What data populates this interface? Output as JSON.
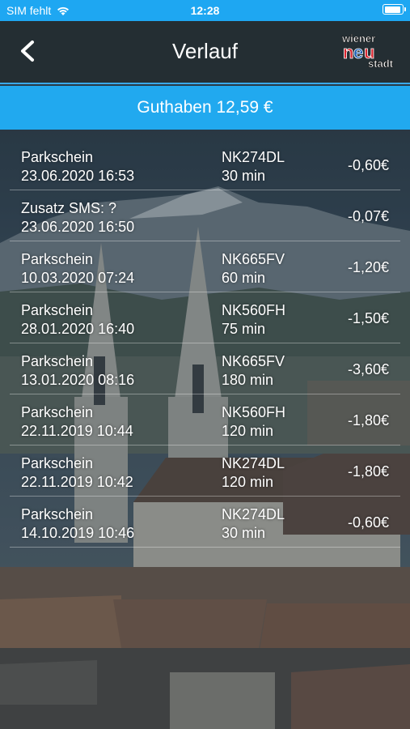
{
  "status_bar": {
    "carrier": "SIM fehlt",
    "time": "12:28"
  },
  "nav": {
    "title": "Verlauf",
    "logo": {
      "line1": "wiener",
      "line2": "neu",
      "line3": "stadt"
    }
  },
  "balance": "Guthaben 12,59 €",
  "history": [
    {
      "type": "Parkschein",
      "datetime": "23.06.2020 16:53",
      "plate": "NK274DL",
      "duration": "30 min",
      "amount": "-0,60€"
    },
    {
      "type": "Zusatz SMS: ?",
      "datetime": "23.06.2020 16:50",
      "plate": "",
      "duration": "",
      "amount": "-0,07€"
    },
    {
      "type": "Parkschein",
      "datetime": "10.03.2020 07:24",
      "plate": "NK665FV",
      "duration": "60 min",
      "amount": "-1,20€"
    },
    {
      "type": "Parkschein",
      "datetime": "28.01.2020 16:40",
      "plate": "NK560FH",
      "duration": "75 min",
      "amount": "-1,50€"
    },
    {
      "type": "Parkschein",
      "datetime": "13.01.2020 08:16",
      "plate": "NK665FV",
      "duration": "180 min",
      "amount": "-3,60€"
    },
    {
      "type": "Parkschein",
      "datetime": "22.11.2019 10:44",
      "plate": "NK560FH",
      "duration": "120 min",
      "amount": "-1,80€"
    },
    {
      "type": "Parkschein",
      "datetime": "22.11.2019 10:42",
      "plate": "NK274DL",
      "duration": "120 min",
      "amount": "-1,80€"
    },
    {
      "type": "Parkschein",
      "datetime": "14.10.2019 10:46",
      "plate": "NK274DL",
      "duration": "30 min",
      "amount": "-0,60€"
    }
  ],
  "colors": {
    "accent": "#21a9ef",
    "navbar": "#242e33",
    "logo_red": "#d9232d",
    "logo_blue": "#1b5fb5"
  }
}
